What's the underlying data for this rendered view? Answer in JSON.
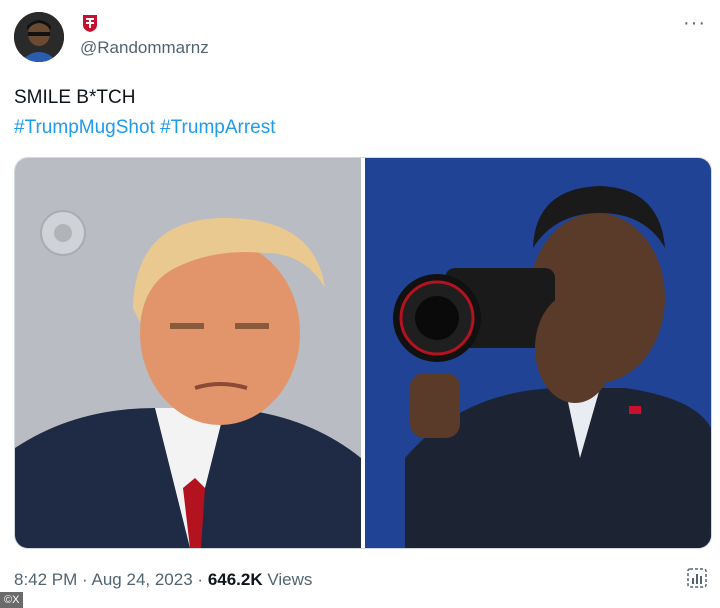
{
  "user": {
    "handle": "@Randommarnz",
    "avatar": "avatar-photo",
    "badge": "red-emblem-icon"
  },
  "tweet": {
    "text": "SMILE B*TCH",
    "hashtags": [
      "#TrumpMugShot",
      "#TrumpArrest"
    ]
  },
  "media": {
    "left_image": "mugshot-photo",
    "right_image": "camera-photographer-photo"
  },
  "meta": {
    "time": "8:42 PM",
    "date": "Aug 24, 2023",
    "separator": "·",
    "views_count": "646.2K",
    "views_label": "Views"
  },
  "source_tag": "©X",
  "colors": {
    "link": "#1d9bf0",
    "secondary_text": "#536471",
    "primary_text": "#0f1419"
  }
}
